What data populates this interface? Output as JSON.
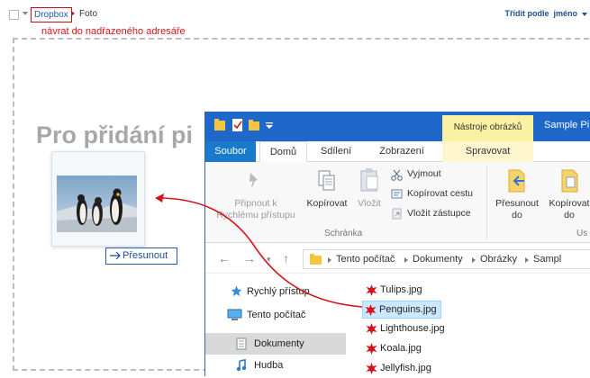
{
  "header": {
    "breadcrumb_root": "Dropbox",
    "breadcrumb_current": "Foto",
    "sort_label": "Třídit podle",
    "sort_value": "jméno",
    "annotation": "návrat do nadřazeného adresáře"
  },
  "dropzone": {
    "title": "Pro přidání pi",
    "move_button": "Přesunout"
  },
  "explorer": {
    "context_tab": "Nástroje obrázků",
    "title": "Sample Pi",
    "tabs": {
      "soubor": "Soubor",
      "domu": "Domů",
      "sdileni": "Sdílení",
      "zobrazeni": "Zobrazení",
      "spravovat": "Spravovat"
    },
    "ribbon": {
      "pin_line1": "Připnout k",
      "pin_line2": "Rychlému přístupu",
      "copy": "Kopírovat",
      "paste": "Vložit",
      "cut": "Vyjmout",
      "copy_path": "Kopírovat cestu",
      "paste_shortcut": "Vložit zástupce",
      "clipboard_group": "Schránka",
      "move_to_line1": "Přesunout",
      "move_to_line2": "do",
      "copy_to_line1": "Kopírovat",
      "copy_to_line2": "do",
      "organize_group": "Us"
    },
    "address": [
      "Tento počítač",
      "Dokumenty",
      "Obrázky",
      "Sampl"
    ],
    "nav": {
      "quick_access": "Rychlý přístup",
      "this_pc": "Tento počítač",
      "documents": "Dokumenty",
      "music": "Hudba"
    },
    "files": [
      "Tulips.jpg",
      "Penguins.jpg",
      "Lighthouse.jpg",
      "Koala.jpg",
      "Jellyfish.jpg"
    ]
  },
  "colors": {
    "accent_red": "#d4141c",
    "explorer_blue": "#1f67c9",
    "link_blue": "#1f4f8f"
  }
}
